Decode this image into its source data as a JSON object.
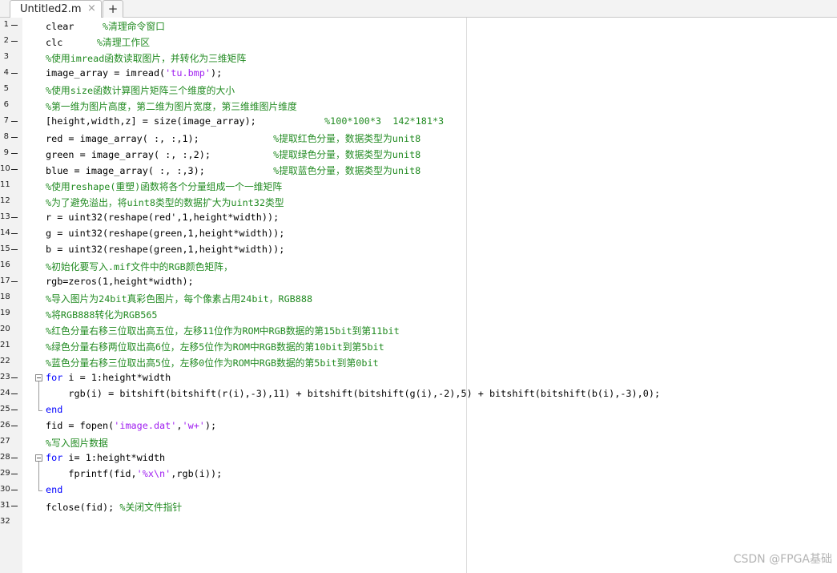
{
  "tabs": {
    "active_label": "Untitled2.m",
    "close_glyph": "×",
    "add_glyph": "+"
  },
  "watermark": "CSDN @FPGA基础",
  "colors": {
    "keyword": "#0000ff",
    "comment": "#228b22",
    "string": "#a020f0",
    "text": "#000000"
  },
  "lines": [
    {
      "n": "1",
      "exec": true,
      "tokens": [
        [
          "t",
          "clear     "
        ],
        [
          "cm",
          "%清理命令窗口"
        ]
      ]
    },
    {
      "n": "2",
      "exec": true,
      "tokens": [
        [
          "t",
          "clc      "
        ],
        [
          "cm",
          "%清理工作区"
        ]
      ]
    },
    {
      "n": "3",
      "exec": false,
      "tokens": [
        [
          "cm",
          "%使用imread函数读取图片，并转化为三维矩阵"
        ]
      ]
    },
    {
      "n": "4",
      "exec": true,
      "tokens": [
        [
          "t",
          "image_array = imread("
        ],
        [
          "str",
          "'tu.bmp'"
        ],
        [
          "t",
          ");"
        ]
      ]
    },
    {
      "n": "5",
      "exec": false,
      "tokens": [
        [
          "cm",
          "%使用size函数计算图片矩阵三个维度的大小"
        ]
      ]
    },
    {
      "n": "6",
      "exec": false,
      "tokens": [
        [
          "cm",
          "%第一维为图片高度，第二维为图片宽度，第三维维图片维度"
        ]
      ]
    },
    {
      "n": "7",
      "exec": true,
      "tokens": [
        [
          "t",
          "[height,width,z] = size(image_array);            "
        ],
        [
          "cm",
          "%100*100*3  142*181*3"
        ]
      ]
    },
    {
      "n": "8",
      "exec": true,
      "tokens": [
        [
          "t",
          "red = image_array( :, :,1);             "
        ],
        [
          "cm",
          "%提取红色分量，数据类型为unit8"
        ]
      ]
    },
    {
      "n": "9",
      "exec": true,
      "tokens": [
        [
          "t",
          "green = image_array( :, :,2);           "
        ],
        [
          "cm",
          "%提取绿色分量，数据类型为unit8"
        ]
      ]
    },
    {
      "n": "10",
      "exec": true,
      "tokens": [
        [
          "t",
          "blue = image_array( :, :,3);            "
        ],
        [
          "cm",
          "%提取蓝色分量，数据类型为unit8"
        ]
      ]
    },
    {
      "n": "11",
      "exec": false,
      "tokens": [
        [
          "cm",
          "%使用reshape(重塑)函数将各个分量组成一个一维矩阵"
        ]
      ]
    },
    {
      "n": "12",
      "exec": false,
      "tokens": [
        [
          "cm",
          "%为了避免溢出，将uint8类型的数据扩大为uint32类型"
        ]
      ]
    },
    {
      "n": "13",
      "exec": true,
      "tokens": [
        [
          "t",
          "r = uint32(reshape(red',1,height*width));"
        ]
      ]
    },
    {
      "n": "14",
      "exec": true,
      "tokens": [
        [
          "t",
          "g = uint32(reshape(green,1,height*width));"
        ]
      ]
    },
    {
      "n": "15",
      "exec": true,
      "tokens": [
        [
          "t",
          "b = uint32(reshape(green,1,height*width));"
        ]
      ]
    },
    {
      "n": "16",
      "exec": false,
      "tokens": [
        [
          "cm",
          "%初始化要写入.mif文件中的RGB颜色矩阵，"
        ]
      ]
    },
    {
      "n": "17",
      "exec": true,
      "tokens": [
        [
          "t",
          "rgb=zeros(1,height*width);"
        ]
      ]
    },
    {
      "n": "18",
      "exec": false,
      "tokens": [
        [
          "cm",
          "%导入图片为24bit真彩色图片，每个像素占用24bit，RGB888"
        ]
      ]
    },
    {
      "n": "19",
      "exec": false,
      "tokens": [
        [
          "cm",
          "%将RGB888转化为RGB565"
        ]
      ]
    },
    {
      "n": "20",
      "exec": false,
      "tokens": [
        [
          "cm",
          "%红色分量右移三位取出高五位，左移11位作为ROM中RGB数据的第15bit到第11bit"
        ]
      ]
    },
    {
      "n": "21",
      "exec": false,
      "tokens": [
        [
          "cm",
          "%绿色分量右移两位取出高6位，左移5位作为ROM中RGB数据的第10bit到第5bit"
        ]
      ]
    },
    {
      "n": "22",
      "exec": false,
      "tokens": [
        [
          "cm",
          "%蓝色分量右移三位取出高5位，左移0位作为ROM中RGB数据的第5bit到第0bit"
        ]
      ]
    },
    {
      "n": "23",
      "exec": true,
      "fold": "start",
      "tokens": [
        [
          "kw",
          "for"
        ],
        [
          "t",
          " i = 1:height*width"
        ]
      ]
    },
    {
      "n": "24",
      "exec": true,
      "fold": "mid",
      "tokens": [
        [
          "t",
          "    rgb(i) = bitshift(bitshift(r(i),-3),11) + bitshift(bitshift(g(i),-2),5) + bitshift(bitshift(b(i),-3),0);"
        ]
      ]
    },
    {
      "n": "25",
      "exec": true,
      "fold": "end",
      "tokens": [
        [
          "kw",
          "end"
        ]
      ]
    },
    {
      "n": "26",
      "exec": true,
      "tokens": [
        [
          "t",
          "fid = fopen("
        ],
        [
          "str",
          "'image.dat'"
        ],
        [
          "t",
          ","
        ],
        [
          "str",
          "'w+'"
        ],
        [
          "t",
          ");"
        ]
      ]
    },
    {
      "n": "27",
      "exec": false,
      "tokens": [
        [
          "cm",
          "%写入图片数据"
        ]
      ]
    },
    {
      "n": "28",
      "exec": true,
      "fold": "start",
      "tokens": [
        [
          "kw",
          "for"
        ],
        [
          "t",
          " i= 1:height*width"
        ]
      ]
    },
    {
      "n": "29",
      "exec": true,
      "fold": "mid",
      "tokens": [
        [
          "t",
          "    fprintf(fid,"
        ],
        [
          "str",
          "'%x\\n'"
        ],
        [
          "t",
          ",rgb(i));"
        ]
      ]
    },
    {
      "n": "30",
      "exec": true,
      "fold": "end",
      "tokens": [
        [
          "kw",
          "end"
        ]
      ]
    },
    {
      "n": "31",
      "exec": true,
      "tokens": [
        [
          "t",
          "fclose(fid); "
        ],
        [
          "cm",
          "%关闭文件指针"
        ]
      ]
    },
    {
      "n": "32",
      "exec": false,
      "tokens": []
    }
  ]
}
